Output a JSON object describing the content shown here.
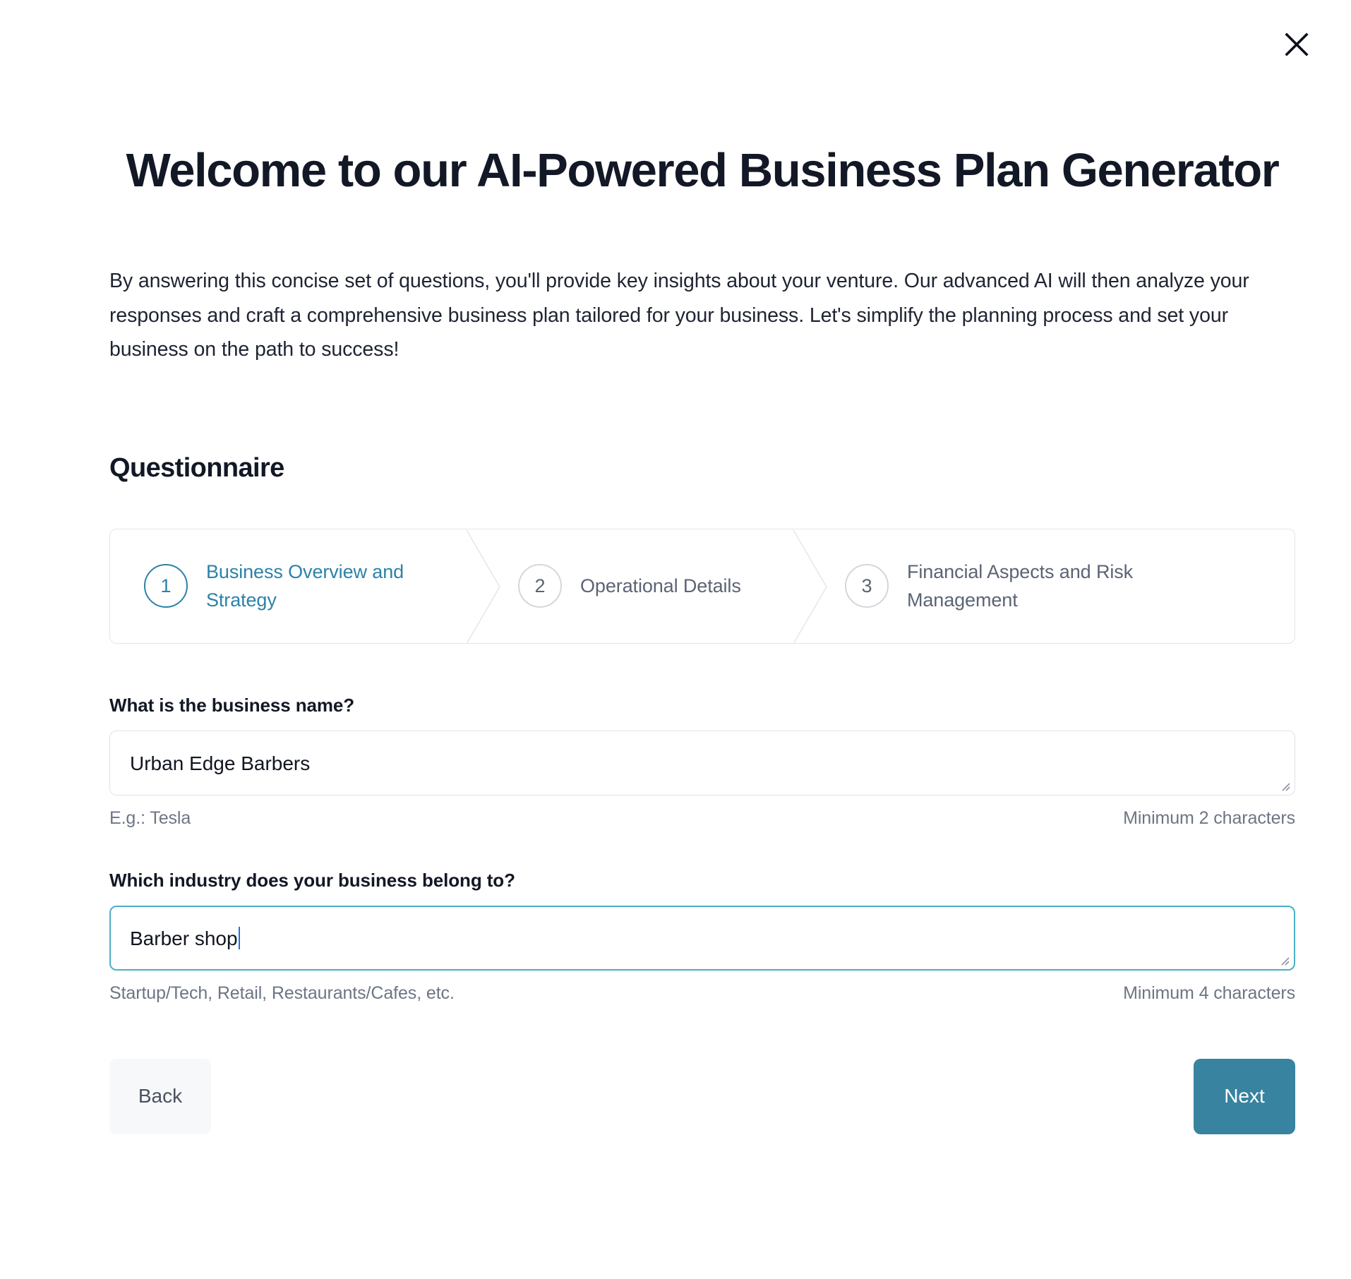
{
  "window": {
    "close_icon": "close-icon"
  },
  "header": {
    "title": "Welcome to our AI-Powered Business Plan Generator",
    "intro": "By answering this concise set of questions, you'll provide key insights about your venture. Our advanced AI will then analyze your responses and craft a comprehensive business plan tailored for your business. Let's simplify the planning process and set your business on the path to success!"
  },
  "questionnaire": {
    "section_title": "Questionnaire",
    "steps": [
      {
        "number": "1",
        "label": "Business Overview and Strategy",
        "state": "active"
      },
      {
        "number": "2",
        "label": "Operational Details",
        "state": "inactive"
      },
      {
        "number": "3",
        "label": "Financial Aspects and Risk Management",
        "state": "inactive"
      }
    ],
    "fields": [
      {
        "label": "What is the business name?",
        "value": "Urban Edge Barbers",
        "hint_left": "E.g.: Tesla",
        "hint_right": "Minimum 2 characters",
        "focused": false
      },
      {
        "label": "Which industry does your business belong to?",
        "value": "Barber shop",
        "hint_left": "Startup/Tech, Retail, Restaurants/Cafes, etc.",
        "hint_right": "Minimum 4 characters",
        "focused": true
      }
    ]
  },
  "footer": {
    "back_label": "Back",
    "next_label": "Next"
  },
  "colors": {
    "accent": "#3783a0",
    "step_active": "#2b82a8",
    "focus_border": "#4ab0c7",
    "caret": "#1a73e8",
    "heading": "#131826",
    "muted": "#6d7585",
    "back_bg": "#f6f8fa"
  }
}
